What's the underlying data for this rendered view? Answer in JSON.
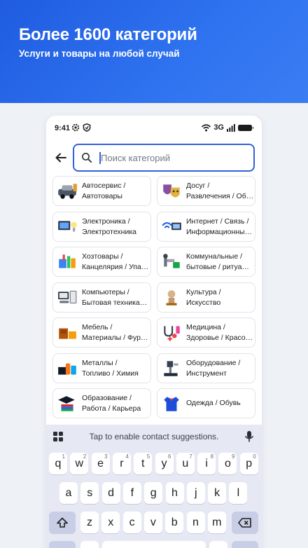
{
  "hero": {
    "title": "Более 1600 категорий",
    "subtitle": "Услуги и товары на любой случай"
  },
  "status_bar": {
    "time": "9:41",
    "network": "3G"
  },
  "search": {
    "placeholder": "Поиск категорий",
    "value": ""
  },
  "categories": [
    {
      "line1": "Автосервис /",
      "line2": "Автотовары",
      "icon": "car-service-icon"
    },
    {
      "line1": "Досуг /",
      "line2": "Развлечения / Об…",
      "icon": "theater-masks-icon"
    },
    {
      "line1": "Электроника /",
      "line2": "Электротехника",
      "icon": "electronics-icon"
    },
    {
      "line1": "Интернет / Связь /",
      "line2": "Информационны…",
      "icon": "internet-icon"
    },
    {
      "line1": "Хозтовары /",
      "line2": "Канцелярия / Упа…",
      "icon": "household-goods-icon"
    },
    {
      "line1": "Коммунальные /",
      "line2": "бытовые / ритуа…",
      "icon": "utilities-icon"
    },
    {
      "line1": "Компьютеры /",
      "line2": "Бытовая техника…",
      "icon": "computers-icon"
    },
    {
      "line1": "Культура /",
      "line2": "Искусство",
      "icon": "culture-icon"
    },
    {
      "line1": "Мебель /",
      "line2": "Материалы / Фур…",
      "icon": "furniture-icon"
    },
    {
      "line1": "Медицина /",
      "line2": "Здоровье / Красо…",
      "icon": "medicine-icon"
    },
    {
      "line1": "Металлы /",
      "line2": "Топливо / Химия",
      "icon": "metals-icon"
    },
    {
      "line1": "Оборудование /",
      "line2": "Инструмент",
      "icon": "equipment-icon"
    },
    {
      "line1": "Образование /",
      "line2": "Работа / Карьера",
      "icon": "education-icon"
    },
    {
      "line1": "Одежда / Обувь",
      "line2": "",
      "icon": "clothing-icon"
    }
  ],
  "keyboard": {
    "suggestion": "Tap to enable contact suggestions.",
    "row1": [
      {
        "k": "q",
        "sup": "1"
      },
      {
        "k": "w",
        "sup": "2"
      },
      {
        "k": "e",
        "sup": "3"
      },
      {
        "k": "r",
        "sup": "4"
      },
      {
        "k": "t",
        "sup": "5"
      },
      {
        "k": "y",
        "sup": "6"
      },
      {
        "k": "u",
        "sup": "7"
      },
      {
        "k": "i",
        "sup": "8"
      },
      {
        "k": "o",
        "sup": "9"
      },
      {
        "k": "p",
        "sup": "0"
      }
    ],
    "row2": [
      "a",
      "s",
      "d",
      "f",
      "g",
      "h",
      "j",
      "k",
      "l"
    ],
    "row3": [
      "z",
      "x",
      "c",
      "v",
      "b",
      "n",
      "m"
    ]
  },
  "colors": {
    "hero_blue": "#2563e8",
    "accent": "#2f63d8"
  }
}
